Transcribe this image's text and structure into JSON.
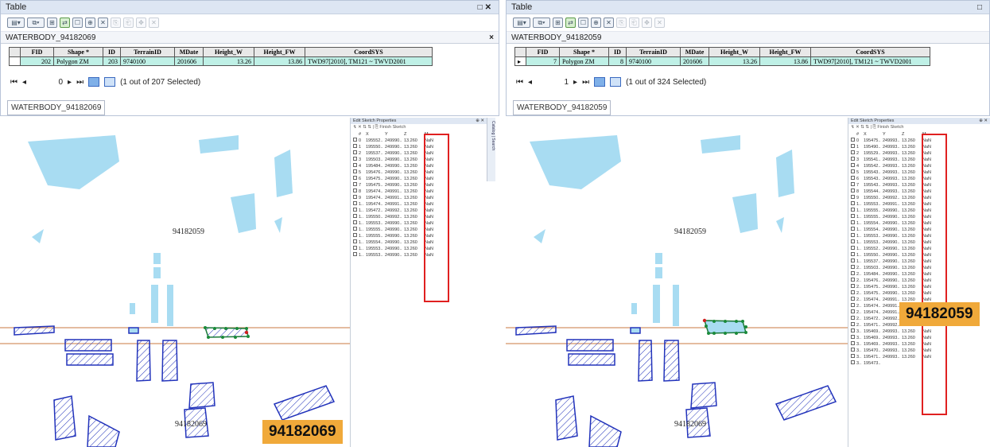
{
  "left": {
    "window_title": "Table",
    "window_buttons": "□✕",
    "layer_name": "WATERBODY_94182069",
    "columns": [
      "FID",
      "Shape *",
      "ID",
      "TerrainID",
      "MDate",
      "Height_W",
      "Height_FW",
      "CoordSYS"
    ],
    "row": [
      "202",
      "Polygon ZM",
      "203",
      "9740100",
      "201606",
      "13.26",
      "13.86",
      "TWD97[2010], TM121 ~ TWVD2001"
    ],
    "record": "0",
    "selection_text": "(1 out of 207 Selected)",
    "layer_button": "WATERBODY_94182069",
    "map_label_top": "94182059",
    "map_label_bottom": "94182069",
    "big_id": "94182069",
    "sketch_title": "Edit Sketch Properties",
    "sketch_tools": "↯ ✕ ⇅ ⇅ | ⎘ Finish Sketch",
    "sketch_head": [
      "#",
      "X",
      "Y",
      "Z",
      "M"
    ],
    "sketch_rows": [
      [
        "0",
        "195552..",
        "249990..",
        "13.260",
        "NaN"
      ],
      [
        "1",
        "195550..",
        "249990..",
        "13.260",
        "NaN"
      ],
      [
        "2",
        "195537..",
        "249990..",
        "13.260",
        "NaN"
      ],
      [
        "3",
        "195503..",
        "249990..",
        "13.260",
        "NaN"
      ],
      [
        "4",
        "195484..",
        "249990..",
        "13.260",
        "NaN"
      ],
      [
        "5",
        "195476..",
        "249990..",
        "13.260",
        "NaN"
      ],
      [
        "6",
        "195475..",
        "249990..",
        "13.260",
        "NaN"
      ],
      [
        "7",
        "195475..",
        "249990..",
        "13.260",
        "NaN"
      ],
      [
        "8",
        "195474..",
        "249991..",
        "13.260",
        "NaN"
      ],
      [
        "9",
        "195474..",
        "249991..",
        "13.260",
        "NaN"
      ],
      [
        "1..",
        "195474..",
        "249991..",
        "13.260",
        "NaN"
      ],
      [
        "1..",
        "195472..",
        "249992..",
        "13.260",
        "NaN"
      ],
      [
        "1..",
        "195550..",
        "249992..",
        "13.260",
        "NaN"
      ],
      [
        "1..",
        "195553..",
        "249990..",
        "13.260",
        "NaN"
      ],
      [
        "1..",
        "195555..",
        "249990..",
        "13.260",
        "NaN"
      ],
      [
        "1..",
        "195555..",
        "249990..",
        "13.260",
        "NaN"
      ],
      [
        "1..",
        "195554..",
        "249990..",
        "13.260",
        "NaN"
      ],
      [
        "1..",
        "195553..",
        "249990..",
        "13.260",
        "NaN"
      ],
      [
        "1..",
        "195553..",
        "249990..",
        "13.260",
        "NaN"
      ]
    ],
    "side_tabs": "Catalog | Search"
  },
  "right": {
    "window_title": "Table",
    "window_buttons": "□",
    "layer_name": "WATERBODY_94182059",
    "columns": [
      "FID",
      "Shape *",
      "ID",
      "TerrainID",
      "MDate",
      "Height_W",
      "Height_FW",
      "CoordSYS"
    ],
    "row": [
      "7",
      "Polygon ZM",
      "8",
      "9740100",
      "201606",
      "13.26",
      "13.86",
      "TWD97[2010], TM121 ~ TWVD2001"
    ],
    "record": "1",
    "selection_text": "(1 out of 324 Selected)",
    "layer_button": "WATERBODY_94182059",
    "map_label_top": "94182059",
    "map_label_bottom": "94182069",
    "big_id": "94182059",
    "sketch_title": "Edit Sketch Properties",
    "sketch_tools": "↯ ✕ ⇅ ⇅ | ⎘ Finish Sketch",
    "sketch_head": [
      "#",
      "X",
      "Y",
      "Z",
      "M"
    ],
    "sketch_rows": [
      [
        "0",
        "195475..",
        "249993..",
        "13.260",
        "NaN"
      ],
      [
        "1",
        "195490..",
        "249993..",
        "13.260",
        "NaN"
      ],
      [
        "2",
        "195529..",
        "249993..",
        "13.260",
        "NaN"
      ],
      [
        "3",
        "195541..",
        "249993..",
        "13.260",
        "NaN"
      ],
      [
        "4",
        "195542..",
        "249993..",
        "13.260",
        "NaN"
      ],
      [
        "5",
        "195543..",
        "249993..",
        "13.260",
        "NaN"
      ],
      [
        "6",
        "195543..",
        "249993..",
        "13.260",
        "NaN"
      ],
      [
        "7",
        "195543..",
        "249993..",
        "13.260",
        "NaN"
      ],
      [
        "8",
        "195544..",
        "249993..",
        "13.260",
        "NaN"
      ],
      [
        "9",
        "195550..",
        "249992..",
        "13.260",
        "NaN"
      ],
      [
        "1..",
        "195553..",
        "249991..",
        "13.260",
        "NaN"
      ],
      [
        "1..",
        "195555..",
        "249990..",
        "13.260",
        "NaN"
      ],
      [
        "1..",
        "195555..",
        "249990..",
        "13.260",
        "NaN"
      ],
      [
        "1..",
        "195554..",
        "249990..",
        "13.260",
        "NaN"
      ],
      [
        "1..",
        "195554..",
        "249990..",
        "13.260",
        "NaN"
      ],
      [
        "1..",
        "195553..",
        "249990..",
        "13.260",
        "NaN"
      ],
      [
        "1..",
        "195553..",
        "249990..",
        "13.260",
        "NaN"
      ],
      [
        "1..",
        "195552..",
        "249990..",
        "13.260",
        "NaN"
      ],
      [
        "1..",
        "195550..",
        "249990..",
        "13.260",
        "NaN"
      ],
      [
        "1..",
        "195537..",
        "249990..",
        "13.260",
        "NaN"
      ],
      [
        "2..",
        "195503..",
        "249990..",
        "13.260",
        "NaN"
      ],
      [
        "2..",
        "195484..",
        "249990..",
        "13.260",
        "NaN"
      ],
      [
        "2..",
        "195476..",
        "249990..",
        "13.260",
        "NaN"
      ],
      [
        "2..",
        "195475..",
        "249990..",
        "13.260",
        "NaN"
      ],
      [
        "2..",
        "195475..",
        "249990..",
        "13.260",
        "NaN"
      ],
      [
        "2..",
        "195474..",
        "249991..",
        "13.260",
        "NaN"
      ],
      [
        "2..",
        "195474..",
        "249991..",
        "13.260",
        "NaN"
      ],
      [
        "2..",
        "195474..",
        "249991..",
        "13.260",
        "NaN"
      ],
      [
        "2..",
        "195472..",
        "249992..",
        "13.260",
        "NaN"
      ],
      [
        "2..",
        "195471..",
        "249992..",
        "13.260",
        "NaN"
      ],
      [
        "3..",
        "195469..",
        "249993..",
        "13.260",
        "NaN"
      ],
      [
        "3..",
        "195469..",
        "249993..",
        "13.260",
        "NaN"
      ],
      [
        "3..",
        "195469..",
        "249993..",
        "13.260",
        "NaN"
      ],
      [
        "3..",
        "195470..",
        "249993..",
        "13.260",
        "NaN"
      ],
      [
        "3..",
        "195471..",
        "249993..",
        "13.260",
        "NaN"
      ],
      [
        "3..",
        "195473..",
        "",
        "",
        ""
      ]
    ]
  },
  "colors": {
    "water_fill": "#a8dcf2",
    "hatch_stroke": "#2233bb",
    "sheet_line": "#c87840",
    "highlight": "#e02020",
    "id_badge": "#f0a93a",
    "row_selected": "#bff0e6"
  }
}
